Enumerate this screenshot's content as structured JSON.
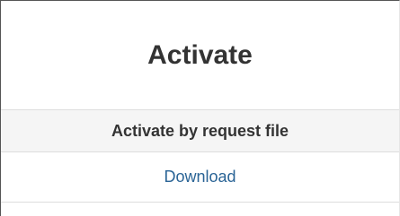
{
  "panel": {
    "title": "Activate"
  },
  "request_section": {
    "heading": "Activate by request file",
    "download_label": "Download"
  }
}
